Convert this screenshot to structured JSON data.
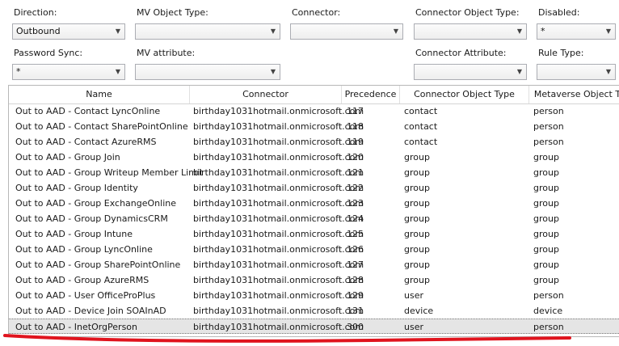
{
  "filters": {
    "direction": {
      "label": "Direction:",
      "value": "Outbound"
    },
    "mv_object_type": {
      "label": "MV Object Type:",
      "value": ""
    },
    "connector": {
      "label": "Connector:",
      "value": ""
    },
    "connector_object_type": {
      "label": "Connector Object Type:",
      "value": ""
    },
    "disabled": {
      "label": "Disabled:",
      "value": "*"
    },
    "password_sync": {
      "label": "Password Sync:",
      "value": "*"
    },
    "mv_attribute": {
      "label": "MV attribute:",
      "value": ""
    },
    "connector_attribute": {
      "label": "Connector Attribute:",
      "value": ""
    },
    "rule_type": {
      "label": "Rule Type:",
      "value": ""
    }
  },
  "table": {
    "columns": [
      "Name",
      "Connector",
      "Precedence",
      "Connector Object Type",
      "Metaverse Object T"
    ],
    "rows": [
      [
        "Out to AAD - Contact LyncOnline",
        "birthday1031hotmail.onmicrosoft.com",
        "117",
        "contact",
        "person"
      ],
      [
        "Out to AAD - Contact SharePointOnline",
        "birthday1031hotmail.onmicrosoft.com",
        "118",
        "contact",
        "person"
      ],
      [
        "Out to AAD - Contact AzureRMS",
        "birthday1031hotmail.onmicrosoft.com",
        "119",
        "contact",
        "person"
      ],
      [
        "Out to AAD - Group Join",
        "birthday1031hotmail.onmicrosoft.com",
        "120",
        "group",
        "group"
      ],
      [
        "Out to AAD - Group Writeup Member Limit",
        "birthday1031hotmail.onmicrosoft.com",
        "121",
        "group",
        "group"
      ],
      [
        "Out to AAD - Group Identity",
        "birthday1031hotmail.onmicrosoft.com",
        "122",
        "group",
        "group"
      ],
      [
        "Out to AAD - Group ExchangeOnline",
        "birthday1031hotmail.onmicrosoft.com",
        "123",
        "group",
        "group"
      ],
      [
        "Out to AAD - Group DynamicsCRM",
        "birthday1031hotmail.onmicrosoft.com",
        "124",
        "group",
        "group"
      ],
      [
        "Out to AAD - Group Intune",
        "birthday1031hotmail.onmicrosoft.com",
        "125",
        "group",
        "group"
      ],
      [
        "Out to AAD - Group LyncOnline",
        "birthday1031hotmail.onmicrosoft.com",
        "126",
        "group",
        "group"
      ],
      [
        "Out to AAD - Group SharePointOnline",
        "birthday1031hotmail.onmicrosoft.com",
        "127",
        "group",
        "group"
      ],
      [
        "Out to AAD - Group AzureRMS",
        "birthday1031hotmail.onmicrosoft.com",
        "128",
        "group",
        "group"
      ],
      [
        "Out to AAD - User OfficeProPlus",
        "birthday1031hotmail.onmicrosoft.com",
        "129",
        "user",
        "person"
      ],
      [
        "Out to AAD - Device Join SOAInAD",
        "birthday1031hotmail.onmicrosoft.com",
        "131",
        "device",
        "device"
      ],
      [
        "Out to AAD - InetOrgPerson",
        "birthday1031hotmail.onmicrosoft.com",
        "300",
        "user",
        "person"
      ]
    ],
    "selected_index": 14
  },
  "colors": {
    "annotation": "#e0141e",
    "selection": "#e5e5e5"
  },
  "icons": {
    "dropdown": "chevron-down-icon"
  }
}
